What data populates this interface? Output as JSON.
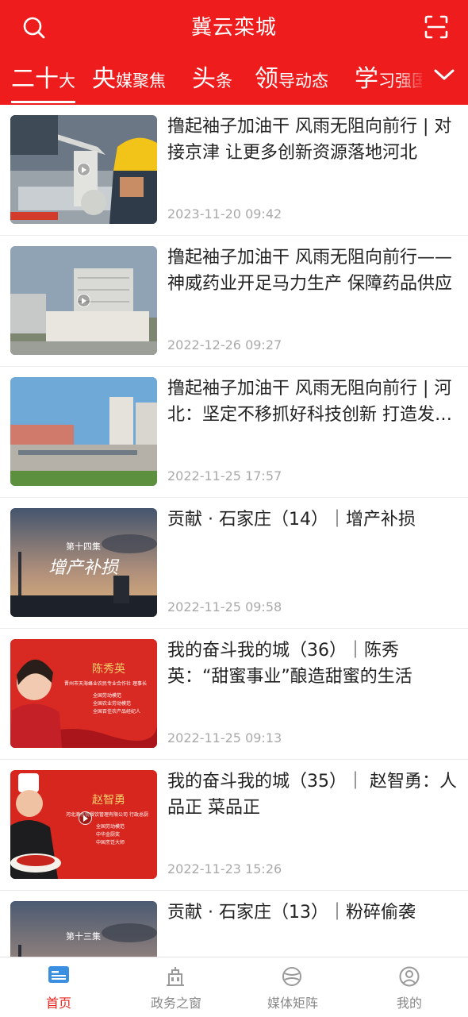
{
  "header": {
    "title": "冀云栾城",
    "search_icon": "search-icon",
    "scan_icon": "scan-icon",
    "bg_color": "#ee1c1c"
  },
  "tabs": [
    {
      "big": "二十",
      "small": "大",
      "active": true
    },
    {
      "big": "央",
      "small": "媒聚焦",
      "active": false
    },
    {
      "big": "头",
      "small": "条",
      "active": false
    },
    {
      "big": "领",
      "small": "导动态",
      "active": false
    },
    {
      "big": "学",
      "small": "习强国",
      "active": false
    }
  ],
  "tab_more_icon": "chevron-down-icon",
  "feed": [
    {
      "title": "撸起袖子加油干 风雨无阻向前行 | 对接京津 让更多创新资源落地河北",
      "time": "2023-11-20 09:42"
    },
    {
      "title": "撸起袖子加油干 风雨无阻向前行——神威药业开足马力生产 保障药品供应",
      "time": "2022-12-26 09:27"
    },
    {
      "title": "撸起袖子加油干 风雨无阻向前行 | 河北：坚定不移抓好科技创新 打造发展新引擎",
      "time": "2022-11-25 17:57"
    },
    {
      "title": "贡献 · 石家庄（14）｜增产补损",
      "time": "2022-11-25 09:58",
      "thumb_text": [
        "第十四集",
        "增产补损"
      ]
    },
    {
      "title": "我的奋斗我的城（36）｜陈秀英：“甜蜜事业”酿造甜蜜的生活",
      "time": "2022-11-25 09:13",
      "thumb_text": [
        "陈秀英",
        "晋州市天海蜂业农民专业合作社 理事长",
        "全国劳动模范",
        "全国农业劳动模范",
        "全国百佳农产品经纪人"
      ]
    },
    {
      "title": "我的奋斗我的城（35）｜ 赵智勇：人品正 菜品正",
      "time": "2022-11-23 15:26",
      "thumb_text": [
        "赵智勇",
        "河北滴水情餐饮管理有限公司 行政总厨",
        "全国劳动模范",
        "中华金厨奖",
        "中国烹饪大师"
      ]
    },
    {
      "title": "贡献 · 石家庄（13）｜粉碎偷袭",
      "time": "",
      "thumb_text": [
        "第十三集"
      ]
    }
  ],
  "tabbar": [
    {
      "label": "首页",
      "icon": "home-icon",
      "active": true
    },
    {
      "label": "政务之窗",
      "icon": "government-building-icon",
      "active": false
    },
    {
      "label": "媒体矩阵",
      "icon": "media-matrix-icon",
      "active": false
    },
    {
      "label": "我的",
      "icon": "profile-icon",
      "active": false
    }
  ],
  "colors": {
    "accent": "#ee1c1c",
    "active_tab_label": "#e8251e",
    "timestamp": "#a9a9a9"
  }
}
